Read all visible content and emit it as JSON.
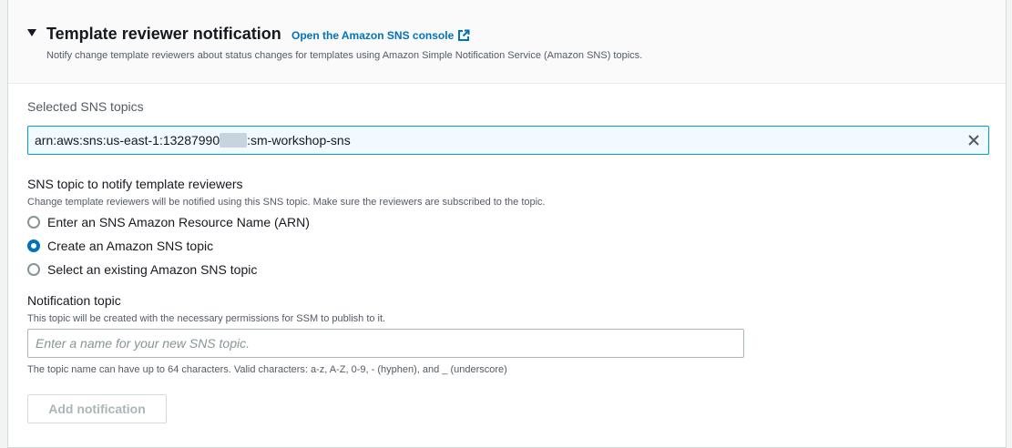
{
  "panel": {
    "title": "Template reviewer notification",
    "console_link": "Open the Amazon SNS console",
    "description": "Notify change template reviewers about status changes for templates using Amazon Simple Notification Service (Amazon SNS) topics."
  },
  "selected_topics": {
    "label": "Selected SNS topics",
    "token": {
      "prefix": "arn:aws:sns:us-east-1:13287990",
      "suffix": ":sm-workshop-sns"
    }
  },
  "notify_section": {
    "label": "SNS topic to notify template reviewers",
    "description": "Change template reviewers will be notified using this SNS topic. Make sure the reviewers are subscribed to the topic.",
    "options": [
      {
        "label": "Enter an SNS Amazon Resource Name (ARN)",
        "checked": false
      },
      {
        "label": "Create an Amazon SNS topic",
        "checked": true
      },
      {
        "label": "Select an existing Amazon SNS topic",
        "checked": false
      }
    ]
  },
  "notification_topic": {
    "label": "Notification topic",
    "description": "This topic will be created with the necessary permissions for SSM to publish to it.",
    "value": "",
    "placeholder": "Enter a name for your new SNS topic.",
    "constraint": "The topic name can have up to 64 characters. Valid characters: a-z, A-Z, 0-9, - (hyphen), and _ (underscore)"
  },
  "add_button": "Add notification",
  "icons": {
    "caret": "caret-down-icon",
    "external": "external-link-icon",
    "close": "close-icon"
  },
  "colors": {
    "link": "#0073bb",
    "token_bg": "#f1faff",
    "token_border": "#00a1c9",
    "radio_checked": "#0073bb",
    "disabled_text": "#aab7b8"
  }
}
